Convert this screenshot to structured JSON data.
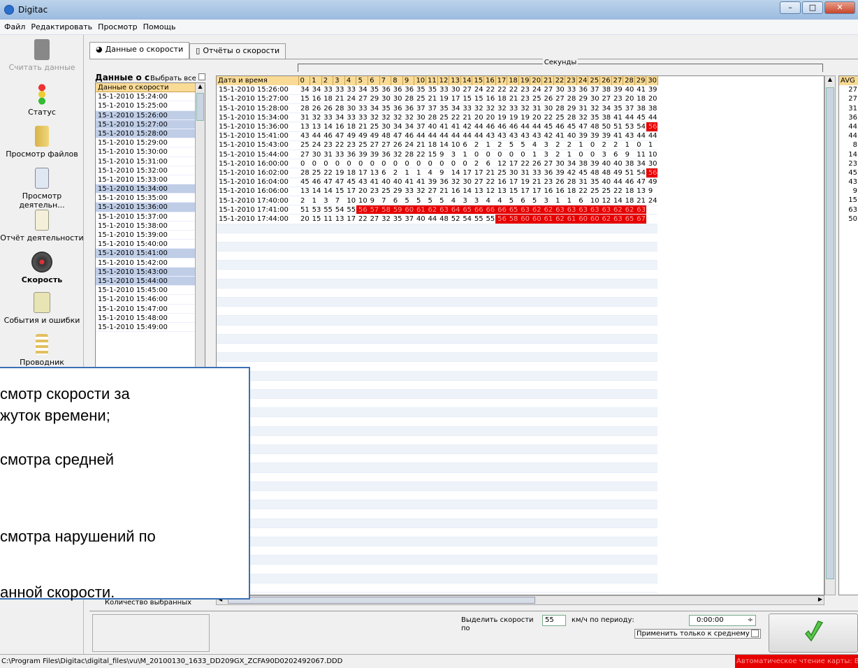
{
  "window": {
    "title": "Digitac"
  },
  "menu": [
    "Файл",
    "Редактировать",
    "Просмотр",
    "Помощь"
  ],
  "sidebar": {
    "items": [
      {
        "label": "Считать данные",
        "icon": "card-reader-icon",
        "disabled": true
      },
      {
        "label": "Статус",
        "icon": "traffic-light-icon"
      },
      {
        "label": "Просмотр файлов",
        "icon": "folder-icon"
      },
      {
        "label": "Просмотр деятельн...",
        "icon": "document-search-icon"
      },
      {
        "label": "Отчёт деятельности",
        "icon": "report-icon"
      },
      {
        "label": "Скорость",
        "icon": "speedometer-icon",
        "active": true
      },
      {
        "label": "События и ошибки",
        "icon": "events-icon"
      },
      {
        "label": "Проводник",
        "icon": "explorer-icon"
      }
    ]
  },
  "tabs": [
    {
      "label": "Данные о скорости",
      "active": true
    },
    {
      "label": "Отчёты о скорости",
      "active": false
    }
  ],
  "left_panel": {
    "title": "Данные о с",
    "select_all": "Выбрать все",
    "header": "Данные о скорости",
    "count_label": "Количество выбранных",
    "rows": [
      {
        "t": "15-1-2010 15:24:00",
        "sel": false
      },
      {
        "t": "15-1-2010 15:25:00",
        "sel": false
      },
      {
        "t": "15-1-2010 15:26:00",
        "sel": true
      },
      {
        "t": "15-1-2010 15:27:00",
        "sel": true
      },
      {
        "t": "15-1-2010 15:28:00",
        "sel": true
      },
      {
        "t": "15-1-2010 15:29:00",
        "sel": false
      },
      {
        "t": "15-1-2010 15:30:00",
        "sel": false
      },
      {
        "t": "15-1-2010 15:31:00",
        "sel": false
      },
      {
        "t": "15-1-2010 15:32:00",
        "sel": false
      },
      {
        "t": "15-1-2010 15:33:00",
        "sel": false
      },
      {
        "t": "15-1-2010 15:34:00",
        "sel": true
      },
      {
        "t": "15-1-2010 15:35:00",
        "sel": false
      },
      {
        "t": "15-1-2010 15:36:00",
        "sel": true
      },
      {
        "t": "15-1-2010 15:37:00",
        "sel": false
      },
      {
        "t": "15-1-2010 15:38:00",
        "sel": false
      },
      {
        "t": "15-1-2010 15:39:00",
        "sel": false
      },
      {
        "t": "15-1-2010 15:40:00",
        "sel": false
      },
      {
        "t": "15-1-2010 15:41:00",
        "sel": true
      },
      {
        "t": "15-1-2010 15:42:00",
        "sel": false
      },
      {
        "t": "15-1-2010 15:43:00",
        "sel": true
      },
      {
        "t": "15-1-2010 15:44:00",
        "sel": true
      },
      {
        "t": "15-1-2010 15:45:00",
        "sel": false
      },
      {
        "t": "15-1-2010 15:46:00",
        "sel": false
      },
      {
        "t": "15-1-2010 15:47:00",
        "sel": false
      },
      {
        "t": "15-1-2010 15:48:00",
        "sel": false
      },
      {
        "t": "15-1-2010 15:49:00",
        "sel": false
      }
    ]
  },
  "grid": {
    "group_label": "Секунды",
    "date_header": "Дата и время",
    "avg_header": "AVG",
    "seconds": [
      "0",
      "1",
      "2",
      "3",
      "4",
      "5",
      "6",
      "7",
      "8",
      "9",
      "10",
      "11",
      "12",
      "13",
      "14",
      "15",
      "16",
      "17",
      "18",
      "19",
      "20",
      "21",
      "22",
      "23",
      "24",
      "25",
      "26",
      "27",
      "28",
      "29",
      "30"
    ],
    "threshold": 55,
    "rows": [
      {
        "t": "15-1-2010 15:26:00",
        "v": [
          34,
          34,
          33,
          33,
          33,
          34,
          35,
          36,
          36,
          36,
          35,
          35,
          33,
          30,
          27,
          24,
          22,
          22,
          22,
          23,
          24,
          27,
          30,
          33,
          36,
          37,
          38,
          39,
          40,
          41,
          39
        ],
        "avg": "27"
      },
      {
        "t": "15-1-2010 15:27:00",
        "v": [
          15,
          16,
          18,
          21,
          24,
          27,
          29,
          30,
          30,
          28,
          25,
          21,
          19,
          17,
          15,
          15,
          16,
          18,
          21,
          23,
          25,
          26,
          27,
          28,
          29,
          30,
          27,
          23,
          20,
          18,
          20
        ],
        "avg": "27"
      },
      {
        "t": "15-1-2010 15:28:00",
        "v": [
          28,
          26,
          26,
          28,
          30,
          33,
          34,
          35,
          36,
          36,
          37,
          37,
          35,
          34,
          33,
          32,
          32,
          32,
          33,
          32,
          31,
          30,
          28,
          29,
          31,
          32,
          34,
          35,
          37,
          38,
          38
        ],
        "avg": "31"
      },
      {
        "t": "15-1-2010 15:34:00",
        "v": [
          31,
          32,
          33,
          34,
          33,
          33,
          32,
          32,
          32,
          32,
          30,
          28,
          25,
          22,
          21,
          20,
          20,
          19,
          19,
          19,
          20,
          22,
          25,
          28,
          32,
          35,
          38,
          41,
          44,
          45,
          44
        ],
        "avg": "36"
      },
      {
        "t": "15-1-2010 15:36:00",
        "v": [
          13,
          13,
          14,
          16,
          18,
          21,
          25,
          30,
          34,
          34,
          37,
          40,
          41,
          41,
          42,
          44,
          46,
          46,
          46,
          44,
          44,
          45,
          46,
          45,
          47,
          48,
          50,
          51,
          53,
          54,
          56
        ],
        "avg": "44"
      },
      {
        "t": "15-1-2010 15:41:00",
        "v": [
          43,
          44,
          46,
          47,
          49,
          49,
          49,
          48,
          47,
          46,
          44,
          44,
          44,
          44,
          44,
          44,
          43,
          43,
          43,
          43,
          43,
          42,
          41,
          40,
          39,
          39,
          39,
          41,
          43,
          44,
          44
        ],
        "avg": "44"
      },
      {
        "t": "15-1-2010 15:43:00",
        "v": [
          25,
          24,
          23,
          22,
          23,
          25,
          27,
          27,
          26,
          24,
          21,
          18,
          14,
          10,
          6,
          2,
          1,
          2,
          5,
          5,
          4,
          3,
          2,
          2,
          1,
          0,
          2,
          2,
          1,
          0,
          1
        ],
        "avg": "8"
      },
      {
        "t": "15-1-2010 15:44:00",
        "v": [
          27,
          30,
          31,
          33,
          36,
          39,
          39,
          36,
          32,
          28,
          22,
          15,
          9,
          3,
          1,
          0,
          0,
          0,
          0,
          0,
          1,
          3,
          2,
          1,
          0,
          0,
          3,
          6,
          9,
          11,
          10
        ],
        "avg": "14"
      },
      {
        "t": "15-1-2010 16:00:00",
        "v": [
          0,
          0,
          0,
          0,
          0,
          0,
          0,
          0,
          0,
          0,
          0,
          0,
          0,
          0,
          0,
          2,
          6,
          12,
          17,
          22,
          26,
          27,
          30,
          34,
          38,
          39,
          40,
          40,
          38,
          34,
          30
        ],
        "avg": "23"
      },
      {
        "t": "15-1-2010 16:02:00",
        "v": [
          28,
          25,
          22,
          19,
          18,
          17,
          13,
          6,
          2,
          1,
          1,
          4,
          9,
          14,
          17,
          17,
          21,
          25,
          30,
          31,
          33,
          36,
          39,
          42,
          45,
          48,
          48,
          49,
          51,
          54,
          56
        ],
        "avg": "45"
      },
      {
        "t": "15-1-2010 16:04:00",
        "v": [
          45,
          46,
          47,
          47,
          45,
          43,
          41,
          40,
          40,
          41,
          41,
          39,
          36,
          32,
          30,
          27,
          22,
          16,
          17,
          19,
          21,
          23,
          26,
          28,
          31,
          35,
          40,
          44,
          46,
          47,
          49
        ],
        "avg": "43"
      },
      {
        "t": "15-1-2010 16:06:00",
        "v": [
          13,
          14,
          14,
          15,
          17,
          20,
          23,
          25,
          29,
          33,
          32,
          27,
          21,
          16,
          14,
          13,
          12,
          13,
          15,
          17,
          17,
          16,
          16,
          18,
          22,
          25,
          25,
          22,
          18,
          13,
          9
        ],
        "avg": "9"
      },
      {
        "t": "15-1-2010 17:40:00",
        "v": [
          2,
          1,
          3,
          7,
          10,
          10,
          9,
          7,
          6,
          5,
          5,
          5,
          5,
          4,
          3,
          3,
          4,
          4,
          5,
          6,
          5,
          3,
          1,
          1,
          6,
          10,
          12,
          14,
          18,
          21,
          24
        ],
        "avg": "15"
      },
      {
        "t": "15-1-2010 17:41:00",
        "v": [
          51,
          53,
          55,
          54,
          55,
          56,
          57,
          58,
          59,
          60,
          61,
          62,
          63,
          64,
          65,
          66,
          66,
          66,
          65,
          63,
          62,
          62,
          63,
          63,
          63,
          63,
          63,
          62,
          62,
          63
        ],
        "avg": "63"
      },
      {
        "t": "15-1-2010 17:44:00",
        "v": [
          20,
          15,
          11,
          13,
          17,
          22,
          27,
          32,
          35,
          37,
          40,
          44,
          48,
          52,
          54,
          55,
          55,
          56,
          58,
          60,
          60,
          61,
          62,
          61,
          60,
          60,
          62,
          63,
          65,
          67
        ],
        "avg": "50"
      }
    ]
  },
  "controls": {
    "highlight_label_1": "Выделить скорости",
    "highlight_label_2": "по",
    "speed_value": "55",
    "kmh_label": "км/ч по периоду:",
    "period_value": "0:00:00",
    "apply_avg_label": "Применить только к среднему"
  },
  "status": {
    "path": "C:\\Program Files\\Digitac\\digital_files\\vu\\M_20100130_1633_DD209GX_ZCFA90D0202492067.DDD",
    "right_text": "Автоматическое чтение карты: Вык"
  },
  "overlay": {
    "lines": [
      "смотр скорости за",
      "жуток времени;",
      "смотра средней",
      "смотра нарушений по",
      "анной скорости."
    ]
  },
  "colors": {
    "violation": "#e60000",
    "header": "#fadb96",
    "selected_row": "#bfcde6",
    "overlay_border": "#3b6fb6"
  }
}
